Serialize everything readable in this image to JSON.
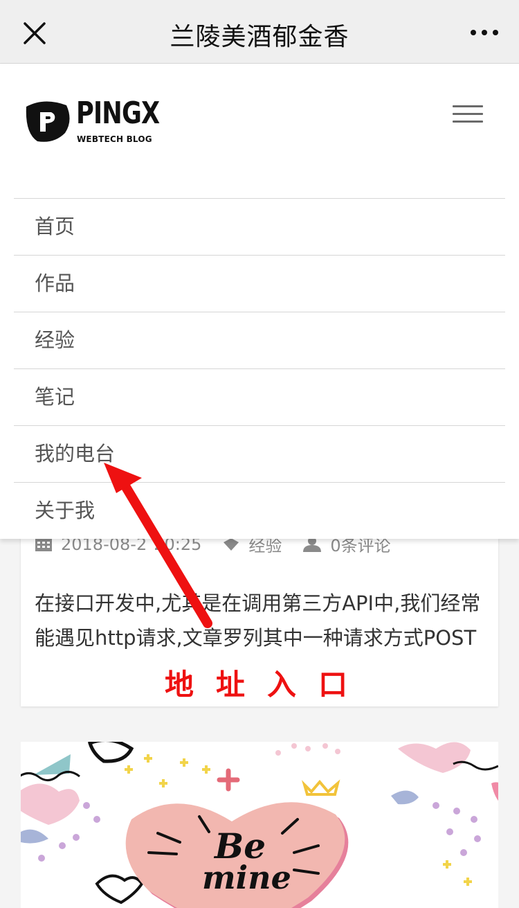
{
  "window": {
    "title": "兰陵美酒郁金香"
  },
  "header": {
    "logo_text": "PINGX",
    "logo_sub": "WEBTECH BLOG"
  },
  "nav": {
    "items": [
      "首页",
      "作品",
      "经验",
      "笔记",
      "我的电台",
      "关于我"
    ]
  },
  "article": {
    "date": "2018-08-2",
    "time": "20:25",
    "category": "经验",
    "comments": "0条评论",
    "excerpt": "在接口开发中,尤其是在调用第三方API中,我们经常能遇见http请求,文章罗列其中一种请求方式POST"
  },
  "annotation": {
    "text": "地址入口",
    "color": "#ee1111"
  },
  "banner": {
    "text_line1": "Be",
    "text_line2": "mine"
  },
  "icons": [
    "close-icon",
    "more-icon",
    "menu-icon",
    "calendar-icon",
    "tag-icon",
    "user-icon"
  ]
}
